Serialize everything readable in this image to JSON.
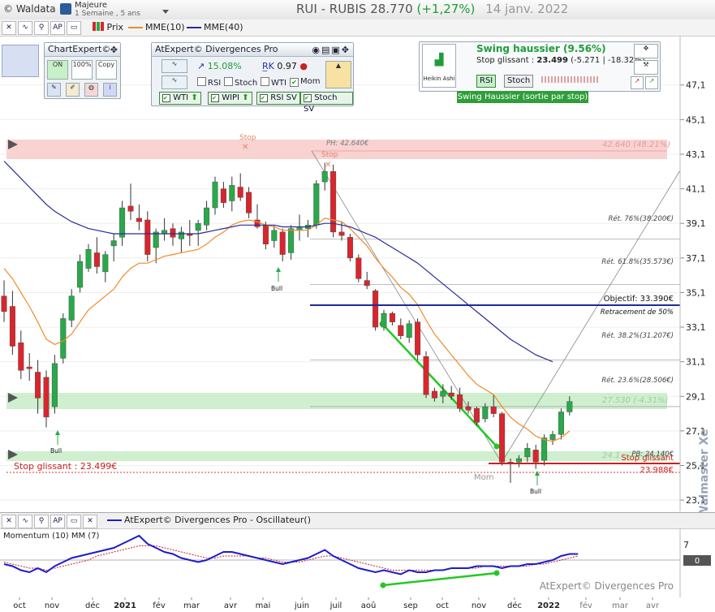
{
  "app": {
    "brand": "© Waldata",
    "period_line1": "Majeure",
    "period_line2": "1 Semaine , 5 ans",
    "ticker": "RUI - RUBIS",
    "price": "28.770",
    "change": "(+1,27%)",
    "date": "14 janv. 2022"
  },
  "toolbar": {
    "price_label": "Prix",
    "mme10_label": "MME(10)",
    "mme40_label": "MME(40)"
  },
  "colors": {
    "mme10": "#f08a2a",
    "mme40": "#2a2a9a",
    "bull": "#2aa84a",
    "bear": "#d8262c",
    "accent_green": "#23c823"
  },
  "chartexpert": {
    "title": "ChartExpert©",
    "on": "ON",
    "pct": "100%",
    "copy": "Copy"
  },
  "atexpert": {
    "title": "AtExpert© Divergences Pro",
    "pct": "15.08%",
    "value": "0.97",
    "rsi": "RSI",
    "stoch": "Stoch",
    "wti": "WTI",
    "mom": "Mom",
    "btn_wti": "WTI",
    "btn_wipi": "WIPI",
    "btn_rsi": "RSI SV",
    "btn_stoch": "Stoch SV"
  },
  "swing": {
    "title": "Swing haussier (9.56%)",
    "sub": "Stop glissant : 23.499 (-5.271 | -18.32%)",
    "sub_prefix": "Stop glissant : ",
    "sub_value": "23.499",
    "sub_suffix": " (-5.271 | -18.32%)",
    "rsi": "RSI",
    "stoch": "Stoch",
    "heikin": "Heikin Ashi",
    "banner": "Swing Haussier (sortie par stop)"
  },
  "annotations": {
    "ph": "PH: 42.640€",
    "pb": "PB: 24.140€",
    "stop_top": "Stop",
    "stop_mid": "Stop",
    "objectif": "Objectif: 33.390€",
    "retracement": "Retracement de 50%",
    "ret76": "Rét. 76%(38.200€)",
    "ret618": "Rét. 61.8%(35.573€)",
    "ret382": "Rét. 38.2%(31.207€)",
    "ret236": "Rét. 23.6%(28.506€)",
    "zone_top": "42.640 (48.21%)",
    "zone_mid": "27.530 (-4.31%)",
    "zone_low": "24.1",
    "stop_glissant_left": "Stop glissant : 23.499€",
    "stop_glissant_right": "Stop glissant",
    "stop_glissant_value": "23.988€",
    "mom": "Mom",
    "bull": "Bull",
    "watermark": "Walmaster Xe"
  },
  "oscillator": {
    "title": "AtExpert© Divergences Pro - Oscillateur()",
    "indicator": "Momentum (10) MM (7)",
    "axis_value": "7",
    "current_value": "0",
    "footer": "AtExpert© Divergences Pro"
  },
  "chart_data": {
    "type": "candlestick",
    "y_ticks": [
      "47,1",
      "45,1",
      "43,1",
      "41,1",
      "39,1",
      "37,1",
      "35,1",
      "33,1",
      "31,1",
      "29,1",
      "27,1",
      "25,1",
      "23,1"
    ],
    "ylim": [
      22.45,
      49.2
    ],
    "x_ticks": [
      "oct",
      "nov",
      "déc",
      "2021",
      "fév",
      "mar",
      "avr",
      "mai",
      "juin",
      "juil",
      "aoû",
      "sep",
      "oct",
      "nov",
      "déc",
      "2022",
      "fév",
      "mar",
      "avr"
    ],
    "candles": [
      {
        "o": 34.9,
        "h": 35.8,
        "l": 33.4,
        "c": 34.0
      },
      {
        "o": 34.3,
        "h": 35.2,
        "l": 31.5,
        "c": 32.0
      },
      {
        "o": 32.2,
        "h": 32.9,
        "l": 30.1,
        "c": 30.6
      },
      {
        "o": 30.8,
        "h": 31.6,
        "l": 30.0,
        "c": 30.7
      },
      {
        "o": 30.5,
        "h": 31.2,
        "l": 28.1,
        "c": 29.0
      },
      {
        "o": 30.2,
        "h": 30.6,
        "l": 27.3,
        "c": 27.9
      },
      {
        "o": 28.5,
        "h": 31.5,
        "l": 28.1,
        "c": 31.0
      },
      {
        "o": 31.3,
        "h": 33.9,
        "l": 31.0,
        "c": 33.6
      },
      {
        "o": 33.5,
        "h": 35.3,
        "l": 33.1,
        "c": 34.9
      },
      {
        "o": 35.4,
        "h": 37.3,
        "l": 35.1,
        "c": 36.9
      },
      {
        "o": 36.5,
        "h": 37.9,
        "l": 36.3,
        "c": 37.6
      },
      {
        "o": 37.4,
        "h": 38.3,
        "l": 36.2,
        "c": 36.6
      },
      {
        "o": 36.3,
        "h": 37.5,
        "l": 35.7,
        "c": 37.3
      },
      {
        "o": 37.8,
        "h": 38.5,
        "l": 36.9,
        "c": 38.1
      },
      {
        "o": 38.3,
        "h": 40.4,
        "l": 37.8,
        "c": 40.0
      },
      {
        "o": 40.1,
        "h": 41.4,
        "l": 39.3,
        "c": 39.8
      },
      {
        "o": 39.4,
        "h": 40.2,
        "l": 38.7,
        "c": 39.2
      },
      {
        "o": 39.3,
        "h": 39.8,
        "l": 36.9,
        "c": 37.3
      },
      {
        "o": 37.7,
        "h": 38.8,
        "l": 36.8,
        "c": 38.6
      },
      {
        "o": 38.5,
        "h": 39.4,
        "l": 38.1,
        "c": 38.7
      },
      {
        "o": 38.8,
        "h": 39.1,
        "l": 37.8,
        "c": 38.3
      },
      {
        "o": 38.2,
        "h": 38.9,
        "l": 37.4,
        "c": 38.6
      },
      {
        "o": 38.5,
        "h": 39.3,
        "l": 37.8,
        "c": 38.4
      },
      {
        "o": 38.7,
        "h": 39.3,
        "l": 37.8,
        "c": 39.1
      },
      {
        "o": 39.0,
        "h": 40.4,
        "l": 38.7,
        "c": 40.0
      },
      {
        "o": 40.0,
        "h": 41.8,
        "l": 39.6,
        "c": 41.5
      },
      {
        "o": 41.1,
        "h": 41.5,
        "l": 40.0,
        "c": 40.3
      },
      {
        "o": 40.4,
        "h": 41.8,
        "l": 39.8,
        "c": 41.3
      },
      {
        "o": 41.2,
        "h": 42.0,
        "l": 40.4,
        "c": 40.6
      },
      {
        "o": 40.9,
        "h": 41.2,
        "l": 39.4,
        "c": 39.7
      },
      {
        "o": 39.3,
        "h": 40.2,
        "l": 38.8,
        "c": 38.9
      },
      {
        "o": 39.0,
        "h": 39.2,
        "l": 37.6,
        "c": 37.9
      },
      {
        "o": 38.1,
        "h": 39.0,
        "l": 37.7,
        "c": 38.7
      },
      {
        "o": 38.6,
        "h": 38.8,
        "l": 36.9,
        "c": 37.3
      },
      {
        "o": 37.4,
        "h": 39.0,
        "l": 37.0,
        "c": 38.8
      },
      {
        "o": 38.7,
        "h": 39.6,
        "l": 38.1,
        "c": 38.9
      },
      {
        "o": 38.8,
        "h": 39.3,
        "l": 38.3,
        "c": 39.0
      },
      {
        "o": 39.0,
        "h": 41.6,
        "l": 38.8,
        "c": 41.4
      },
      {
        "o": 41.5,
        "h": 42.6,
        "l": 41.0,
        "c": 42.1
      },
      {
        "o": 42.1,
        "h": 42.5,
        "l": 38.3,
        "c": 38.6
      },
      {
        "o": 38.6,
        "h": 39.2,
        "l": 38.1,
        "c": 38.4
      },
      {
        "o": 38.3,
        "h": 38.5,
        "l": 36.9,
        "c": 37.1
      },
      {
        "o": 37.1,
        "h": 37.3,
        "l": 35.7,
        "c": 35.9
      },
      {
        "o": 35.8,
        "h": 36.3,
        "l": 35.3,
        "c": 35.5
      },
      {
        "o": 35.2,
        "h": 35.3,
        "l": 32.9,
        "c": 33.1
      },
      {
        "o": 33.1,
        "h": 34.1,
        "l": 32.9,
        "c": 33.9
      },
      {
        "o": 33.9,
        "h": 34.0,
        "l": 33.2,
        "c": 33.4
      },
      {
        "o": 33.2,
        "h": 33.6,
        "l": 32.4,
        "c": 32.6
      },
      {
        "o": 32.5,
        "h": 33.5,
        "l": 32.2,
        "c": 33.3
      },
      {
        "o": 33.4,
        "h": 33.6,
        "l": 31.2,
        "c": 31.5
      },
      {
        "o": 31.4,
        "h": 31.7,
        "l": 29.0,
        "c": 29.2
      },
      {
        "o": 29.4,
        "h": 29.6,
        "l": 28.8,
        "c": 29.0
      },
      {
        "o": 29.1,
        "h": 29.8,
        "l": 28.7,
        "c": 29.4
      },
      {
        "o": 29.3,
        "h": 29.7,
        "l": 28.9,
        "c": 29.1
      },
      {
        "o": 29.2,
        "h": 29.6,
        "l": 28.2,
        "c": 28.4
      },
      {
        "o": 28.5,
        "h": 28.8,
        "l": 28.1,
        "c": 28.3
      },
      {
        "o": 28.4,
        "h": 28.5,
        "l": 27.4,
        "c": 27.6
      },
      {
        "o": 27.8,
        "h": 28.7,
        "l": 27.6,
        "c": 28.5
      },
      {
        "o": 28.5,
        "h": 29.2,
        "l": 27.9,
        "c": 28.1
      },
      {
        "o": 28.1,
        "h": 28.2,
        "l": 25.1,
        "c": 25.3
      },
      {
        "o": 25.3,
        "h": 25.5,
        "l": 24.1,
        "c": 25.2
      },
      {
        "o": 25.3,
        "h": 25.7,
        "l": 25.0,
        "c": 25.5
      },
      {
        "o": 25.6,
        "h": 26.4,
        "l": 25.3,
        "c": 26.1
      },
      {
        "o": 26.0,
        "h": 26.3,
        "l": 24.9,
        "c": 25.3
      },
      {
        "o": 25.4,
        "h": 26.9,
        "l": 25.1,
        "c": 26.7
      },
      {
        "o": 26.6,
        "h": 27.1,
        "l": 26.3,
        "c": 26.9
      },
      {
        "o": 26.9,
        "h": 28.4,
        "l": 26.6,
        "c": 28.2
      },
      {
        "o": 28.2,
        "h": 29.1,
        "l": 28.0,
        "c": 28.8
      }
    ],
    "series": [
      {
        "name": "MME(10)",
        "values": [
          36.5,
          35.9,
          35.1,
          34.3,
          33.4,
          32.4,
          32.1,
          32.3,
          32.7,
          33.4,
          34.1,
          34.5,
          34.9,
          35.3,
          36.0,
          36.5,
          36.8,
          36.8,
          37.0,
          37.2,
          37.3,
          37.4,
          37.5,
          37.6,
          37.9,
          38.3,
          38.6,
          39.0,
          39.2,
          39.3,
          39.2,
          39.0,
          38.9,
          38.7,
          38.7,
          38.7,
          38.7,
          39.0,
          39.4,
          39.3,
          39.2,
          38.8,
          38.3,
          37.8,
          37.1,
          36.5,
          36.0,
          35.4,
          35.0,
          34.4,
          33.5,
          32.7,
          32.1,
          31.5,
          30.9,
          30.3,
          29.8,
          29.5,
          29.2,
          28.5,
          27.9,
          27.5,
          27.2,
          26.8,
          26.6,
          26.5,
          26.7,
          27.1
        ]
      },
      {
        "name": "MME(40)",
        "values": [
          42.7,
          42.2,
          41.7,
          41.2,
          40.7,
          40.2,
          39.8,
          39.5,
          39.2,
          39.0,
          38.8,
          38.7,
          38.6,
          38.5,
          38.5,
          38.5,
          38.5,
          38.5,
          38.5,
          38.5,
          38.5,
          38.5,
          38.5,
          38.5,
          38.6,
          38.7,
          38.8,
          38.9,
          39.0,
          39.0,
          39.0,
          39.0,
          39.0,
          38.9,
          38.9,
          38.9,
          38.9,
          39.0,
          39.1,
          39.1,
          39.0,
          38.9,
          38.7,
          38.5,
          38.3,
          38.0,
          37.7,
          37.4,
          37.1,
          36.8,
          36.4,
          36.0,
          35.6,
          35.2,
          34.8,
          34.4,
          34.0,
          33.6,
          33.2,
          32.8,
          32.4,
          32.1,
          31.8,
          31.5,
          31.3,
          31.1
        ]
      }
    ],
    "levels": [
      {
        "label": "Rét. 76%(38.200€)",
        "value": 38.2
      },
      {
        "label": "Rét. 61.8%(35.573€)",
        "value": 35.573
      },
      {
        "label": "Objectif: 33.390€",
        "value": 33.39
      },
      {
        "label": "Rét. 38.2%(31.207€)",
        "value": 31.207
      },
      {
        "label": "Rét. 23.6%(28.506€)",
        "value": 28.506
      },
      {
        "label": "PB: 24.140€",
        "value": 24.14
      },
      {
        "label": "Stop glissant",
        "value": 23.988
      },
      {
        "label": "Stop glissant : 23.499€",
        "value": 23.499
      }
    ],
    "momentum": {
      "ylim": [
        -12,
        12
      ],
      "values": [
        -2,
        -3,
        -5,
        -6,
        -4,
        -6,
        -3,
        -1,
        1,
        2,
        3,
        4,
        5,
        6,
        8,
        10,
        12,
        8,
        6,
        4,
        3,
        1,
        0,
        -1,
        0,
        2,
        4,
        4,
        3,
        2,
        1,
        0,
        -1,
        -2,
        -1,
        0,
        1,
        3,
        5,
        2,
        0,
        -2,
        -4,
        -5,
        -6,
        -5,
        -6,
        -7,
        -5,
        -6,
        -6,
        -5,
        -5,
        -4,
        -4,
        -4,
        -3,
        -3,
        -3,
        -4,
        -3,
        -3,
        -2,
        -2,
        -1,
        0,
        2,
        3,
        3
      ],
      "signal": [
        -1,
        -2,
        -3,
        -4,
        -4,
        -5,
        -4,
        -3,
        -2,
        -1,
        0,
        2,
        3,
        4,
        5,
        6,
        7,
        7,
        7,
        6,
        5,
        4,
        3,
        2,
        1,
        1,
        2,
        2,
        2,
        2,
        1,
        1,
        0,
        -1,
        -1,
        -1,
        0,
        1,
        2,
        2,
        1,
        0,
        -1,
        -2,
        -3,
        -4,
        -5,
        -5,
        -5,
        -5,
        -5,
        -5,
        -5,
        -4,
        -4,
        -4,
        -4,
        -3,
        -3,
        -3,
        -3,
        -3,
        -3,
        -2,
        -2,
        -1,
        0,
        1,
        2
      ]
    }
  }
}
